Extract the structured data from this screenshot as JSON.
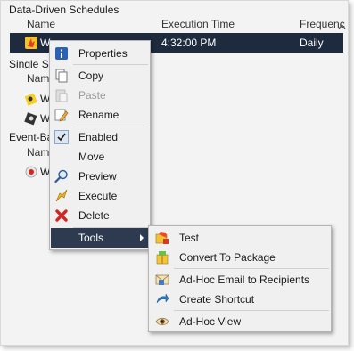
{
  "sections": {
    "data_driven": {
      "title": "Data-Driven Schedules",
      "columns": [
        "Name",
        "Execution Time",
        "Frequenc"
      ],
      "selected_row": {
        "name": "W",
        "time": "4:32:00 PM",
        "frequency": "Daily"
      }
    },
    "single": {
      "title": "Single Sc",
      "column": "Name",
      "rows": [
        "W",
        "W"
      ]
    },
    "event_based": {
      "title": "Event-Ba",
      "column": "Name",
      "rows": [
        "W"
      ]
    }
  },
  "context_menu": {
    "items": [
      {
        "label": "Properties",
        "icon": "info-icon",
        "enabled": true
      },
      {
        "label": "Copy",
        "icon": "copy-icon",
        "enabled": true
      },
      {
        "label": "Paste",
        "icon": "paste-icon",
        "enabled": false
      },
      {
        "label": "Rename",
        "icon": "rename-icon",
        "enabled": true
      },
      {
        "label": "Enabled",
        "icon": "check-icon",
        "enabled": true,
        "checked": true
      },
      {
        "label": "Move",
        "icon": "",
        "enabled": true
      },
      {
        "label": "Preview",
        "icon": "magnifier-icon",
        "enabled": true
      },
      {
        "label": "Execute",
        "icon": "execute-icon",
        "enabled": true
      },
      {
        "label": "Delete",
        "icon": "delete-x-icon",
        "enabled": true
      },
      {
        "label": "Tools",
        "icon": "",
        "enabled": true,
        "has_submenu": true
      }
    ]
  },
  "tools_submenu": {
    "items": [
      {
        "label": "Test",
        "icon": "test-icon"
      },
      {
        "label": "Convert To Package",
        "icon": "package-icon"
      },
      {
        "label": "Ad-Hoc Email to Recipients",
        "icon": "email-icon"
      },
      {
        "label": "Create Shortcut",
        "icon": "shortcut-icon"
      },
      {
        "label": "Ad-Hoc View",
        "icon": "eye-icon"
      }
    ]
  },
  "colors": {
    "selection": "#1e2a3e",
    "menu_hover": "#2d3a4f",
    "delete_red": "#d4261c",
    "info_blue": "#2a62b4"
  }
}
